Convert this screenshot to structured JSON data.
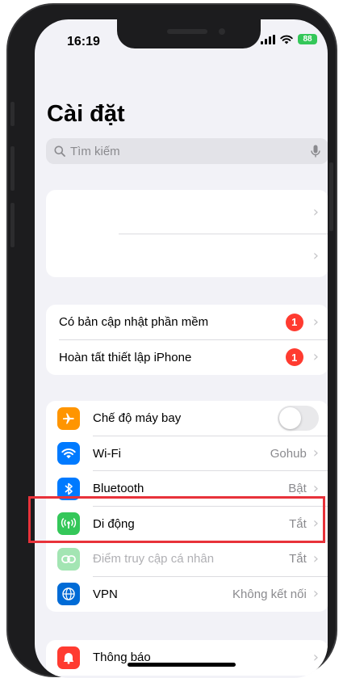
{
  "status_bar": {
    "time": "16:19",
    "battery": "88"
  },
  "header": {
    "title": "Cài đặt"
  },
  "search": {
    "placeholder": "Tìm kiếm"
  },
  "account_group": {
    "rows": [
      "",
      ""
    ]
  },
  "updates_group": {
    "rows": [
      {
        "label": "Có bản cập nhật phần mềm",
        "badge": "1"
      },
      {
        "label": "Hoàn tất thiết lập iPhone",
        "badge": "1"
      }
    ]
  },
  "connectivity_group": {
    "rows": [
      {
        "label": "Chế độ máy bay",
        "toggle_on": false,
        "icon": "airplane-icon",
        "icon_color": "#ff9500"
      },
      {
        "label": "Wi-Fi",
        "value": "Gohub",
        "icon": "wifi-icon",
        "icon_color": "#007aff"
      },
      {
        "label": "Bluetooth",
        "value": "Bật",
        "icon": "bluetooth-icon",
        "icon_color": "#007aff"
      },
      {
        "label": "Di động",
        "value": "Tắt",
        "icon": "cellular-icon",
        "icon_color": "#34c759"
      },
      {
        "label": "Điểm truy cập cá nhân",
        "value": "Tắt",
        "icon": "hotspot-icon",
        "icon_color": "#34c759"
      },
      {
        "label": "VPN",
        "value": "Không kết nối",
        "icon": "vpn-icon",
        "icon_color": "#006bd6"
      }
    ]
  },
  "notifications_group": {
    "rows": [
      {
        "label": "Thông báo",
        "icon": "bell-icon",
        "icon_color": "#ff3b30"
      }
    ]
  },
  "highlight": {
    "color": "#e8323a",
    "target": "Di động"
  }
}
